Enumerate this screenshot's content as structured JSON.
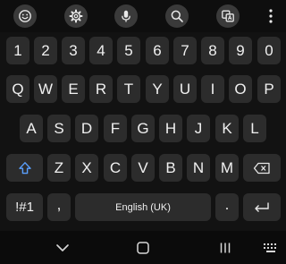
{
  "toolbar": {
    "buttons": [
      "emoji",
      "settings",
      "voice-input",
      "search",
      "translate"
    ],
    "more_icon": "more-dots-icon"
  },
  "keyboard": {
    "number_row": [
      "1",
      "2",
      "3",
      "4",
      "5",
      "6",
      "7",
      "8",
      "9",
      "0"
    ],
    "row_q": [
      "Q",
      "W",
      "E",
      "R",
      "T",
      "Y",
      "U",
      "I",
      "O",
      "P"
    ],
    "row_a": [
      "A",
      "S",
      "D",
      "F",
      "G",
      "H",
      "J",
      "K",
      "L"
    ],
    "row_z": [
      "Z",
      "X",
      "C",
      "V",
      "B",
      "N",
      "M"
    ],
    "symbols_label": "!#1",
    "comma_label": ",",
    "space_label": "English (UK)",
    "period_label": ".",
    "shift_icon": "shift-icon",
    "backspace_icon": "backspace-icon",
    "enter_icon": "enter-icon"
  },
  "navbar": {
    "buttons": [
      "hide-keyboard",
      "home",
      "recent-apps",
      "keyboard-switch"
    ]
  },
  "colors": {
    "key_background": "#2c2c2c",
    "key_text": "#f0f0f0",
    "toolbar_button": "#3a3a3a",
    "shift_accent": "#5aa0ff",
    "keyboard_background": "#121212"
  }
}
